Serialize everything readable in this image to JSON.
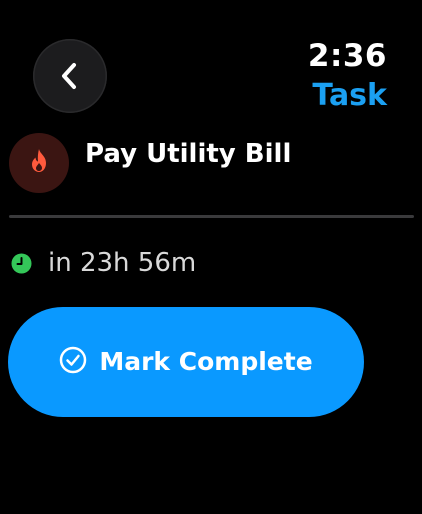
{
  "status": {
    "time": "2:36"
  },
  "nav": {
    "title": "Task",
    "back_icon": "chevron-left-icon"
  },
  "task": {
    "title": "Pay Utility Bill",
    "icon": "flame-icon",
    "icon_color": "#ff5a3d",
    "icon_bg": "#3b1512"
  },
  "due": {
    "text": "in 23h 56m",
    "icon": "clock-icon",
    "icon_color": "#34c759"
  },
  "actions": {
    "complete_label": "Mark Complete",
    "complete_icon": "checkmark-circle-icon"
  },
  "colors": {
    "accent": "#0a99ff",
    "title_accent": "#1ba0f2",
    "background": "#000000"
  }
}
